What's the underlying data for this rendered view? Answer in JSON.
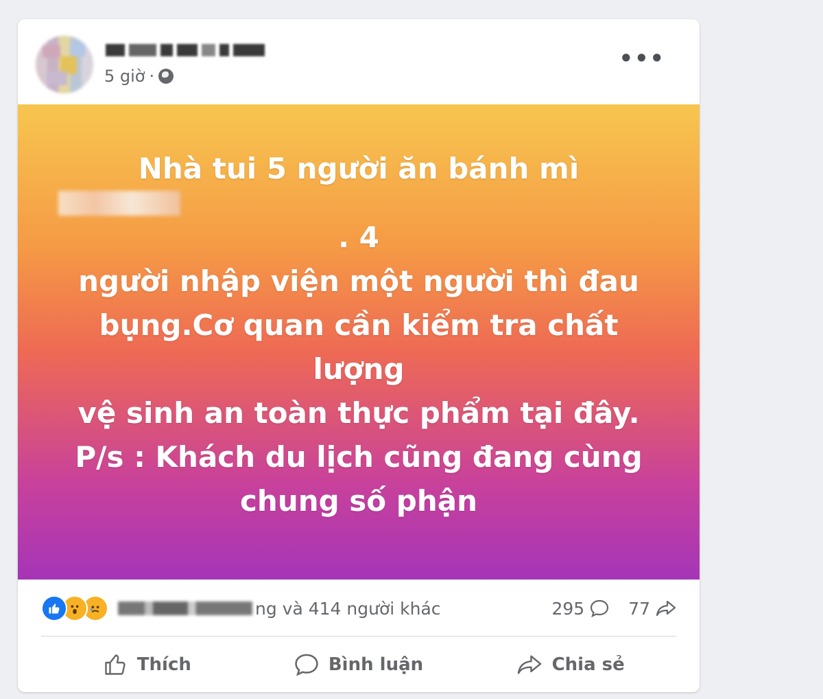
{
  "post": {
    "time": "5 giờ",
    "separator": "·",
    "privacy_icon": "globe-icon",
    "more_icon": "more-options-icon",
    "more_label": "•••",
    "text_lines": [
      "Nhà tui 5 người ăn bánh mì",
      ". 4",
      "người nhập viện một người thì đau",
      "bụng.Cơ quan cần kiểm tra chất lượng",
      "vệ sinh an toàn thực phẩm tại đây.",
      "P/s : Khách du lịch cũng đang cùng",
      "chung số phận"
    ],
    "background_colors": [
      "#f7c64f",
      "#f59a45",
      "#ee6a54",
      "#c8419c",
      "#a535b7"
    ]
  },
  "reactions": {
    "icons": [
      "like-icon",
      "wow-icon",
      "sad-icon"
    ],
    "summary": "ng và 414 người khác",
    "comments_count": "295",
    "shares_count": "77"
  },
  "actions": {
    "like_label": "Thích",
    "comment_label": "Bình luận",
    "share_label": "Chia sẻ"
  },
  "colors": {
    "like_blue": "#1877f2",
    "reaction_yellow": "#f7b125",
    "secondary_text": "#65676b"
  }
}
